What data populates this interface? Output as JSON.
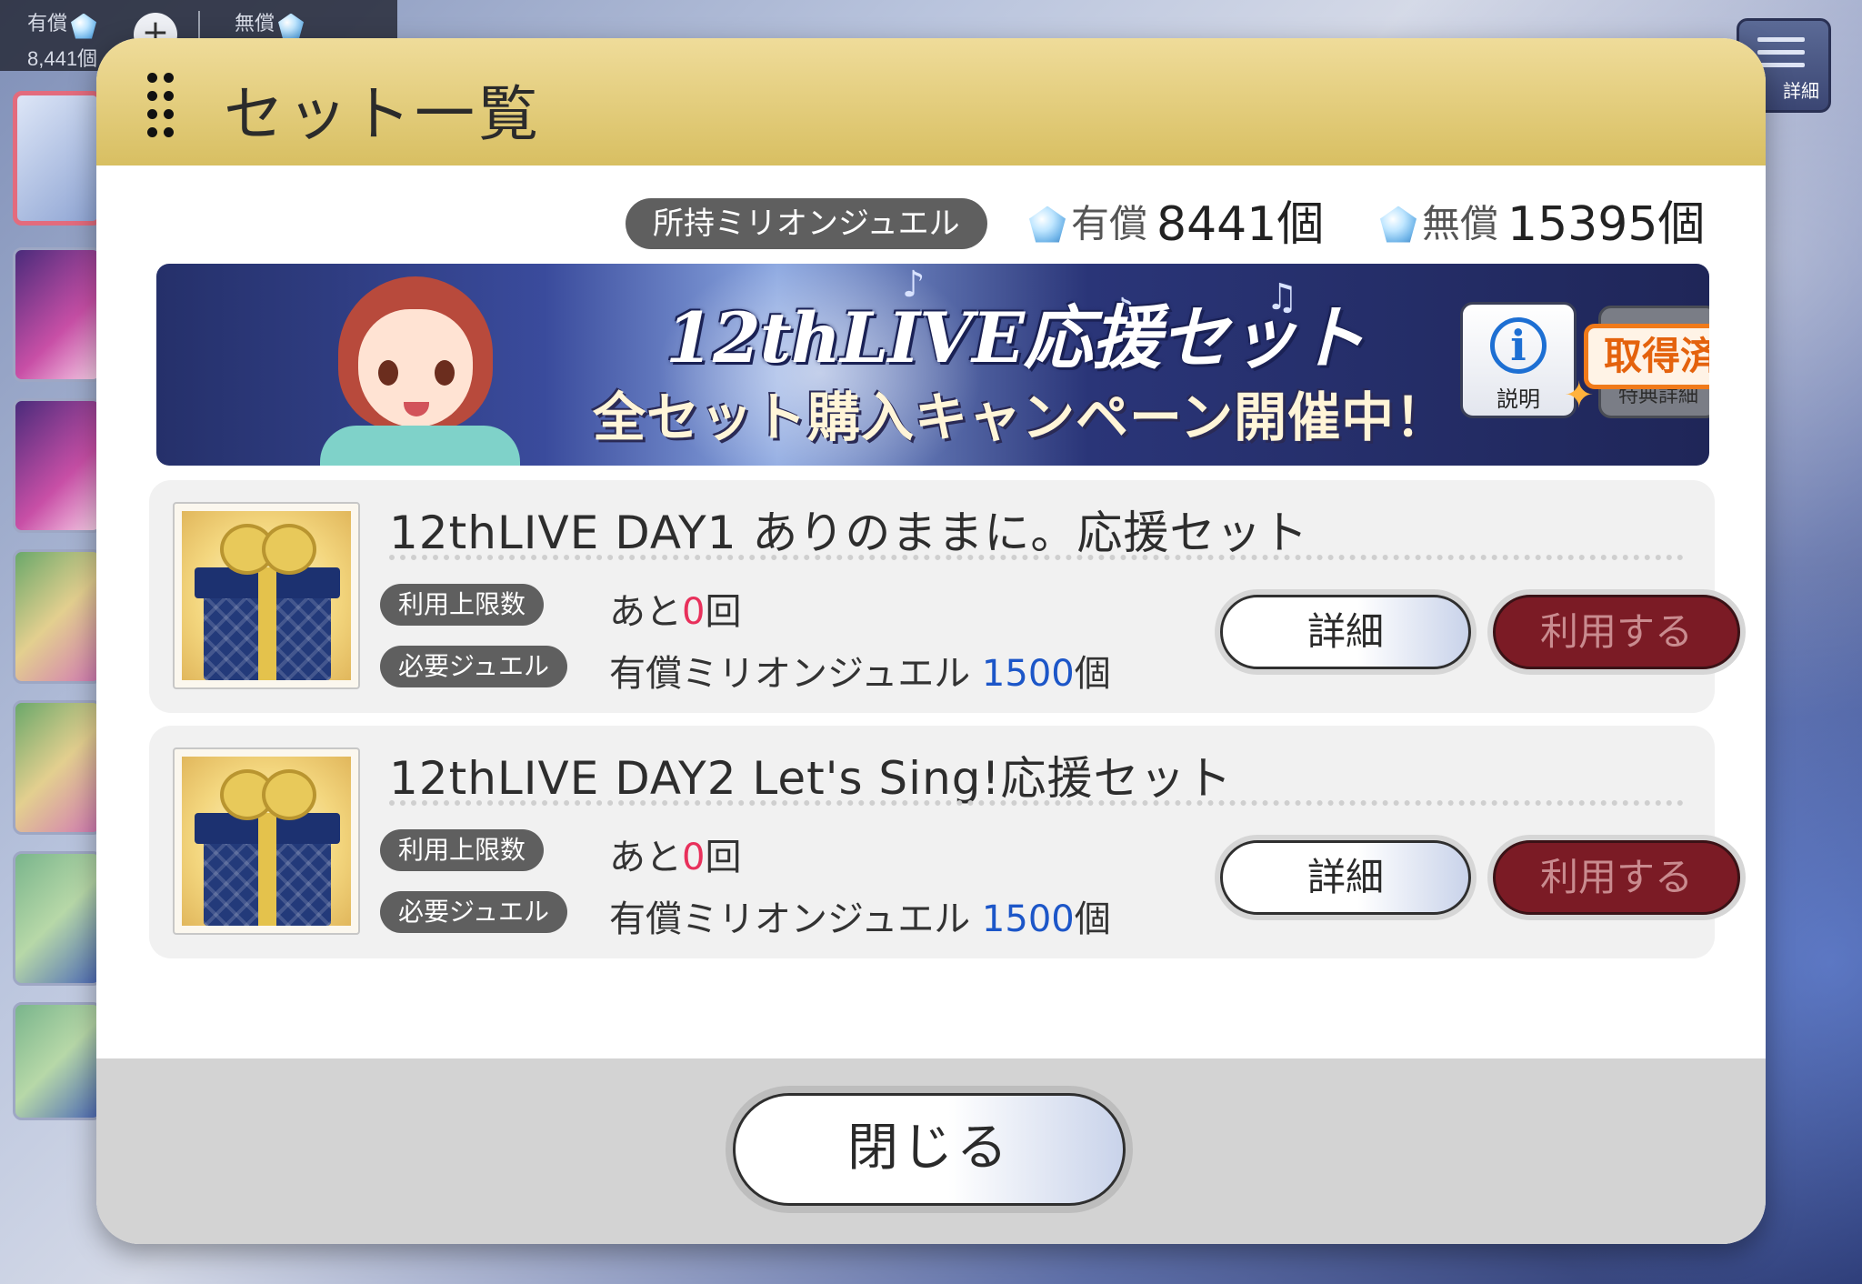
{
  "top_bar": {
    "paid_label": "有償",
    "paid_value": "8,441個",
    "free_label": "無償",
    "plus": "+"
  },
  "top_right": {
    "detail_label": "詳細"
  },
  "modal": {
    "title": "セット一覧",
    "balance": {
      "owned_label": "所持ミリオンジュエル",
      "paid_label": "有償",
      "paid_value": "8441個",
      "free_label": "無償",
      "free_value": "15395個"
    },
    "banner": {
      "title_line1": "12thLIVE応援セット",
      "title_line2": "全セット購入キャンペーン開催中！",
      "info_label": "説明",
      "acquired_label": "取得済",
      "under_label": "特典詳細"
    },
    "sets": [
      {
        "name": "12thLIVE DAY1 ありのままに。応援セット",
        "limit_label": "利用上限数",
        "remaining_prefix": "あと",
        "remaining_value": "0",
        "remaining_suffix": "回",
        "jewel_label": "必要ジュエル",
        "jewel_prefix": "有償ミリオンジュエル ",
        "jewel_value": "1500",
        "jewel_suffix": "個",
        "detail_button": "詳細",
        "use_button": "利用する"
      },
      {
        "name": "12thLIVE DAY2 Let's Sing!応援セット",
        "limit_label": "利用上限数",
        "remaining_prefix": "あと",
        "remaining_value": "0",
        "remaining_suffix": "回",
        "jewel_label": "必要ジュエル",
        "jewel_prefix": "有償ミリオンジュエル ",
        "jewel_value": "1500",
        "jewel_suffix": "個",
        "detail_button": "詳細",
        "use_button": "利用する"
      }
    ],
    "close_button": "閉じる"
  },
  "colors": {
    "header_gold": "#d8bf62",
    "remaining_red": "#e8305b",
    "jewel_blue": "#1c56c8",
    "use_button": "#7b1b25",
    "acquired_orange": "#f07a1a"
  }
}
